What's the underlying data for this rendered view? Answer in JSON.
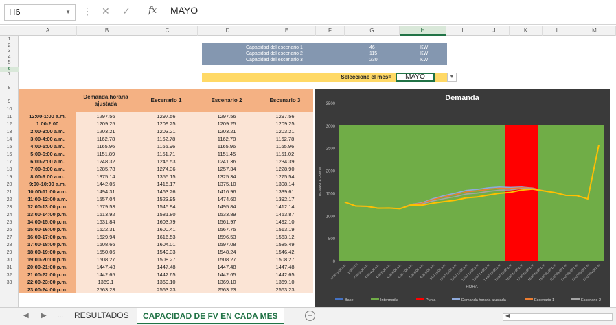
{
  "formula_bar": {
    "name_box": "H6",
    "fx_label": "fx",
    "value": "MAYO"
  },
  "columns": [
    "A",
    "B",
    "C",
    "D",
    "E",
    "F",
    "G",
    "H",
    "I",
    "J",
    "K",
    "L",
    "M"
  ],
  "selected_column": "H",
  "rows": [
    "1",
    "2",
    "3",
    "4",
    "5",
    "6",
    "7",
    "8",
    "9",
    "10",
    "11",
    "12",
    "13",
    "14",
    "15",
    "16",
    "17",
    "18",
    "19",
    "20",
    "21",
    "22",
    "23",
    "24",
    "25",
    "26",
    "27",
    "28",
    "29",
    "30",
    "31",
    "32",
    "33"
  ],
  "selected_row": "6",
  "scenario_box": {
    "rows": [
      {
        "label": "Capacidad del escenario 1",
        "value": "46",
        "unit": "KW"
      },
      {
        "label": "Capacidad del escenario 2",
        "value": "115",
        "unit": "KW"
      },
      {
        "label": "Capacidad del escenario 3",
        "value": "230",
        "unit": "KW"
      }
    ]
  },
  "month_selector": {
    "label": "Seleccione el mes=",
    "value": "MAYO"
  },
  "table": {
    "headers": [
      "",
      "Demanda horaria ajustada",
      "Escenario 1",
      "Escenario 2",
      "Escenario 3"
    ],
    "rows": [
      [
        "12:00-1:00 a.m.",
        "1297.56",
        "1297.56",
        "1297.56",
        "1297.56"
      ],
      [
        "1:00-2:00",
        "1209.25",
        "1209.25",
        "1209.25",
        "1209.25"
      ],
      [
        "2:00-3:00 a.m.",
        "1203.21",
        "1203.21",
        "1203.21",
        "1203.21"
      ],
      [
        "3:00-4:00 a.m.",
        "1162.78",
        "1162.78",
        "1162.78",
        "1162.78"
      ],
      [
        "4:00-5:00 a.m.",
        "1165.96",
        "1165.96",
        "1165.96",
        "1165.96"
      ],
      [
        "5:00-6:00 a.m.",
        "1151.89",
        "1151.71",
        "1151.45",
        "1151.02"
      ],
      [
        "6:00-7:00 a.m.",
        "1248.32",
        "1245.53",
        "1241.36",
        "1234.39"
      ],
      [
        "7:00-8:00 a.m.",
        "1285.78",
        "1274.36",
        "1257.34",
        "1228.90"
      ],
      [
        "8:00-9:00 a.m.",
        "1375.14",
        "1355.15",
        "1325.34",
        "1275.54"
      ],
      [
        "9:00-10:00 a.m.",
        "1442.05",
        "1415.17",
        "1375.10",
        "1308.14"
      ],
      [
        "10:00-11:00 a.m.",
        "1494.31",
        "1463.26",
        "1416.96",
        "1339.61"
      ],
      [
        "11:00-12:00 a.m.",
        "1557.04",
        "1523.95",
        "1474.60",
        "1392.17"
      ],
      [
        "12:00-13:00 p.m.",
        "1579.53",
        "1545.94",
        "1495.84",
        "1412.14"
      ],
      [
        "13:00-14:00 p.m.",
        "1613.92",
        "1581.80",
        "1533.89",
        "1453.87"
      ],
      [
        "14:00-15:00 p.m.",
        "1631.84",
        "1603.79",
        "1561.97",
        "1492.10"
      ],
      [
        "15:00-16:00 p.m.",
        "1622.31",
        "1600.41",
        "1567.75",
        "1513.19"
      ],
      [
        "16:00-17:00 p.m.",
        "1629.94",
        "1616.53",
        "1596.53",
        "1563.12"
      ],
      [
        "17:00-18:00 p.m.",
        "1608.66",
        "1604.01",
        "1597.08",
        "1585.49"
      ],
      [
        "18:00-19:00 p.m.",
        "1550.06",
        "1549.33",
        "1548.24",
        "1546.42"
      ],
      [
        "19:00-20:00 p.m.",
        "1508.27",
        "1508.27",
        "1508.27",
        "1508.27"
      ],
      [
        "20:00-21:00 p.m.",
        "1447.48",
        "1447.48",
        "1447.48",
        "1447.48"
      ],
      [
        "21:00-22:00 p.m.",
        "1442.65",
        "1442.65",
        "1442.65",
        "1442.65"
      ],
      [
        "22:00-23:00 p.m.",
        "1369.1",
        "1369.10",
        "1369.10",
        "1369.10"
      ],
      [
        "23:00-24:00 p.m.",
        "2563.23",
        "2563.23",
        "2563.23",
        "2563.23"
      ]
    ]
  },
  "chart_data": {
    "type": "line",
    "title": "Demanda",
    "xlabel": "HORA",
    "ylabel": "DEMANDA EN KW",
    "ylim": [
      0,
      3500
    ],
    "yticks": [
      "0",
      "500",
      "1000",
      "1500",
      "2000",
      "2500",
      "3000",
      "3500"
    ],
    "categories": [
      "12:00-1:00 a.m.",
      "1:00-2:00",
      "2:00-3:00 a.m.",
      "3:00-4:00 a.m.",
      "4:00-5:00 a.m.",
      "5:00-6:00 a.m.",
      "6:00-7:00 a.m.",
      "7:00-8:00 a.m.",
      "8:00-9:00 a.m.",
      "9:00-10:00 a.m.",
      "10:00-11:00 a.m.",
      "11:00-12:00 a.m.",
      "12:00-13:00 p.m.",
      "13:00-14:00 p.m.",
      "14:00-15:00 p.m.",
      "15:00-16:00 p.m.",
      "16:00-17:00 p.m.",
      "17:00-18:00 p.m.",
      "18:00-19:00 p.m.",
      "19:00-20:00 p.m.",
      "20:00-21:00 p.m.",
      "21:00-22:00 p.m.",
      "22:00-23:00 p.m.",
      "23:00-24:00 p.m."
    ],
    "bands": [
      {
        "name": "Base",
        "color": "#4472c4",
        "value": 0
      },
      {
        "name": "Intermedia",
        "color": "#70ad47",
        "value": 3000
      },
      {
        "name": "Punta",
        "color": "#ff0000",
        "value": 3000,
        "from": "15:00-16:00 p.m.",
        "to": "17:00-18:00 p.m."
      }
    ],
    "series": [
      {
        "name": "Demanda horaria ajustada",
        "color": "#8faadc",
        "values": [
          1297.56,
          1209.25,
          1203.21,
          1162.78,
          1165.96,
          1151.89,
          1248.32,
          1285.78,
          1375.14,
          1442.05,
          1494.31,
          1557.04,
          1579.53,
          1613.92,
          1631.84,
          1622.31,
          1629.94,
          1608.66,
          1550.06,
          1508.27,
          1447.48,
          1442.65,
          1369.1,
          2563.23
        ]
      },
      {
        "name": "Escenario 1",
        "color": "#ed7d31",
        "values": [
          1297.56,
          1209.25,
          1203.21,
          1162.78,
          1165.96,
          1151.71,
          1245.53,
          1274.36,
          1355.15,
          1415.17,
          1463.26,
          1523.95,
          1545.94,
          1581.8,
          1603.79,
          1600.41,
          1616.53,
          1604.01,
          1549.33,
          1508.27,
          1447.48,
          1442.65,
          1369.1,
          2563.23
        ]
      },
      {
        "name": "Escenario 2",
        "color": "#a5a5a5",
        "values": [
          1297.56,
          1209.25,
          1203.21,
          1162.78,
          1165.96,
          1151.45,
          1241.36,
          1257.34,
          1325.34,
          1375.1,
          1416.96,
          1474.6,
          1495.84,
          1533.89,
          1561.97,
          1567.75,
          1596.53,
          1597.08,
          1548.24,
          1508.27,
          1447.48,
          1442.65,
          1369.1,
          2563.23
        ]
      },
      {
        "name": "Escenario 3",
        "color": "#ffc000",
        "values": [
          1297.56,
          1209.25,
          1203.21,
          1162.78,
          1165.96,
          1151.02,
          1234.39,
          1228.9,
          1275.54,
          1308.14,
          1339.61,
          1392.17,
          1412.14,
          1453.87,
          1492.1,
          1513.19,
          1563.12,
          1585.49,
          1546.42,
          1508.27,
          1447.48,
          1442.65,
          1369.1,
          2563.23
        ]
      }
    ],
    "legend": "bottom",
    "grid": false
  },
  "sheet_tabs": {
    "nav_more": "...",
    "tabs": [
      "RESULTADOS",
      "CAPACIDAD DE FV EN CADA MES"
    ],
    "active": "CAPACIDAD DE FV EN CADA MES",
    "add": "+"
  }
}
